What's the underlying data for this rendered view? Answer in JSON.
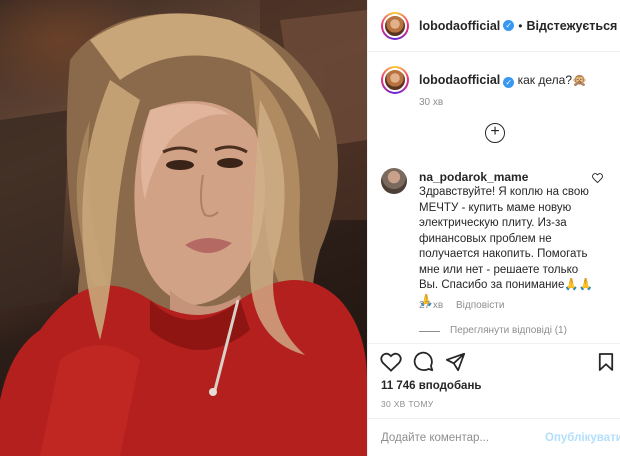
{
  "post": {
    "image_alt": "",
    "header": {
      "username": "lobodaofficial",
      "separator": "•",
      "follow_label": "Відстежується"
    },
    "caption": {
      "username": "lobodaofficial",
      "text": "как дела?🙊",
      "time": "30 хв"
    },
    "comment": {
      "username": "na_podarok_mame",
      "text": "Здравствуйте! Я коплю на свою\nМЕЧТУ - купить маме новую\nэлектрическую плиту. Из-за\nфинансовых проблем не\nполучается накопить. Помогать\nмне или нет - решаете только\nВы. Спасибо за понимание🙏🙏\n🙏",
      "time": "27 хв",
      "reply_label": "Відповісти",
      "view_replies_label": "Переглянути відповіді (1)"
    },
    "likes": "11 746 вподобань",
    "time_ago": "30 ХВ ТОМУ",
    "add_comment": {
      "placeholder": "Додайте коментар...",
      "publish_label": "Опублікувати"
    },
    "colors": {
      "verified": "#3897f0",
      "publish_disabled": "#b2dffc",
      "secondary_text": "#8e8e8e"
    },
    "icons": [
      "verified-badge-icon",
      "plus-circle-icon",
      "heart-icon",
      "comment-icon",
      "share-icon",
      "bookmark-icon"
    ]
  }
}
